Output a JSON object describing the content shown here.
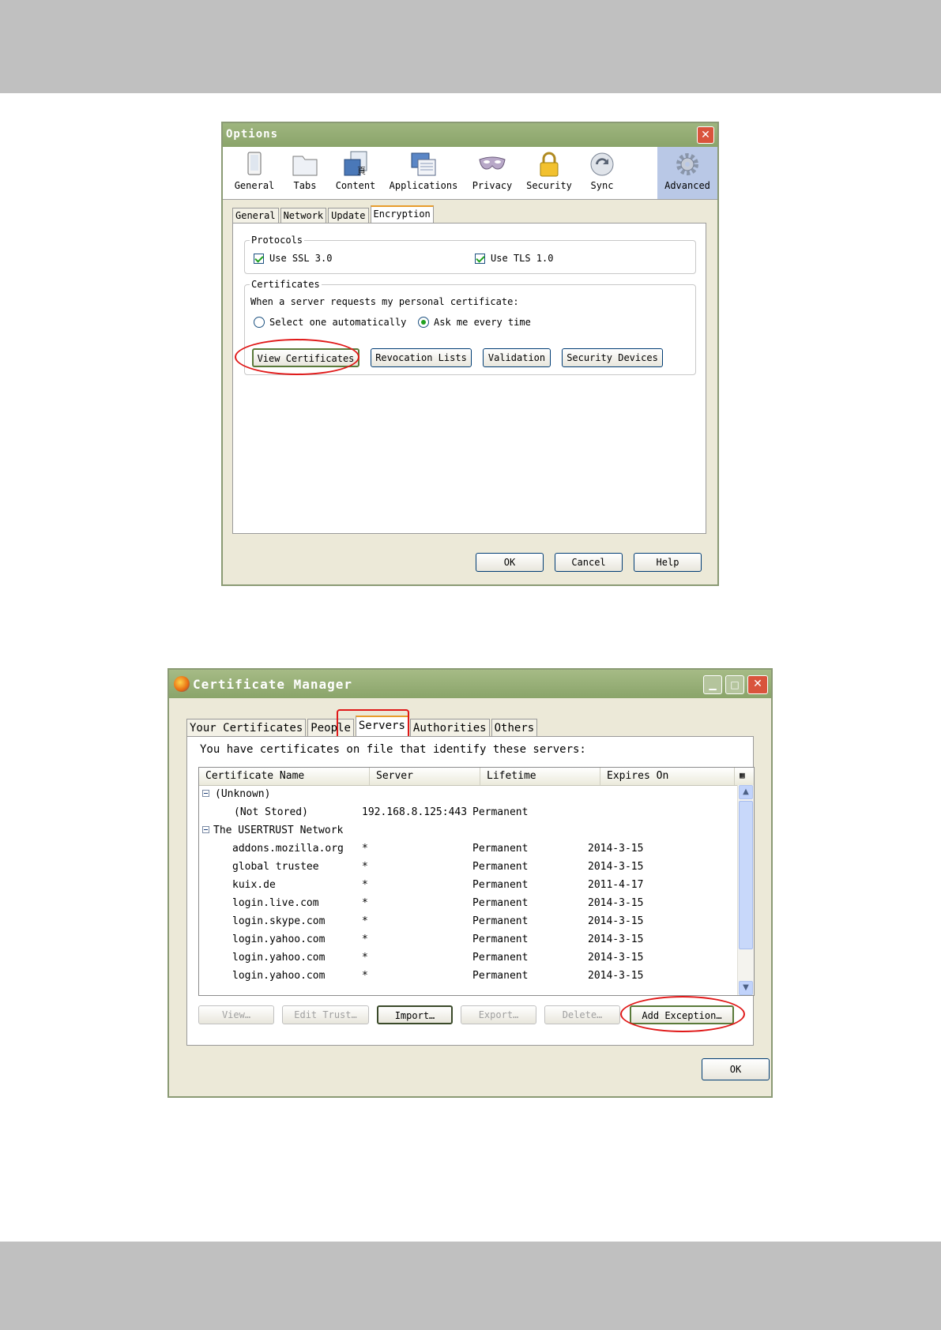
{
  "options_dialog": {
    "title": "Options",
    "toolbar": [
      {
        "label": "General",
        "icon": "general-icon"
      },
      {
        "label": "Tabs",
        "icon": "tabs-icon"
      },
      {
        "label": "Content",
        "icon": "content-icon"
      },
      {
        "label": "Applications",
        "icon": "applications-icon"
      },
      {
        "label": "Privacy",
        "icon": "privacy-mask-icon"
      },
      {
        "label": "Security",
        "icon": "padlock-icon"
      },
      {
        "label": "Sync",
        "icon": "sync-icon"
      },
      {
        "label": "Advanced",
        "icon": "gear-icon"
      }
    ],
    "active_toolbar": "Advanced",
    "subtabs": [
      "General",
      "Network",
      "Update",
      "Encryption"
    ],
    "active_subtab": "Encryption",
    "protocols": {
      "legend": "Protocols",
      "ssl_label": "Use SSL 3.0",
      "ssl_checked": true,
      "tls_label": "Use TLS 1.0",
      "tls_checked": true
    },
    "certificates": {
      "legend": "Certificates",
      "prompt": "When a server requests my personal certificate:",
      "radio_auto": "Select one automatically",
      "radio_ask": "Ask me every time",
      "selected": "Ask me every time",
      "buttons": {
        "view": "View Certificates",
        "revocation": "Revocation Lists",
        "validation": "Validation",
        "devices": "Security Devices"
      }
    },
    "footer": {
      "ok": "OK",
      "cancel": "Cancel",
      "help": "Help"
    }
  },
  "cert_manager": {
    "title": "Certificate Manager",
    "tabs": [
      "Your Certificates",
      "People",
      "Servers",
      "Authorities",
      "Others"
    ],
    "active_tab": "Servers",
    "intro": "You have certificates on file that identify these servers:",
    "columns": [
      "Certificate Name",
      "Server",
      "Lifetime",
      "Expires On"
    ],
    "groups": [
      {
        "name": "(Unknown)",
        "rows": [
          {
            "name": "(Not Stored)",
            "server": "192.168.8.125:443",
            "lifetime": "Permanent",
            "expires": ""
          }
        ]
      },
      {
        "name": "The USERTRUST Network",
        "rows": [
          {
            "name": "addons.mozilla.org",
            "server": "*",
            "lifetime": "Permanent",
            "expires": "2014-3-15"
          },
          {
            "name": "global trustee",
            "server": "*",
            "lifetime": "Permanent",
            "expires": "2014-3-15"
          },
          {
            "name": "kuix.de",
            "server": "*",
            "lifetime": "Permanent",
            "expires": "2011-4-17"
          },
          {
            "name": "login.live.com",
            "server": "*",
            "lifetime": "Permanent",
            "expires": "2014-3-15"
          },
          {
            "name": "login.skype.com",
            "server": "*",
            "lifetime": "Permanent",
            "expires": "2014-3-15"
          },
          {
            "name": "login.yahoo.com",
            "server": "*",
            "lifetime": "Permanent",
            "expires": "2014-3-15"
          },
          {
            "name": "login.yahoo.com",
            "server": "*",
            "lifetime": "Permanent",
            "expires": "2014-3-15"
          },
          {
            "name": "login.yahoo.com",
            "server": "*",
            "lifetime": "Permanent",
            "expires": "2014-3-15"
          }
        ]
      }
    ],
    "buttons": {
      "view": "View…",
      "edit_trust": "Edit Trust…",
      "import": "Import…",
      "export": "Export…",
      "delete": "Delete…",
      "add_exception": "Add Exception…"
    },
    "ok": "OK"
  },
  "colors": {
    "highlight": "#e01818",
    "titlebar": "#9eb57e",
    "dialog_bg": "#ece9d8"
  }
}
